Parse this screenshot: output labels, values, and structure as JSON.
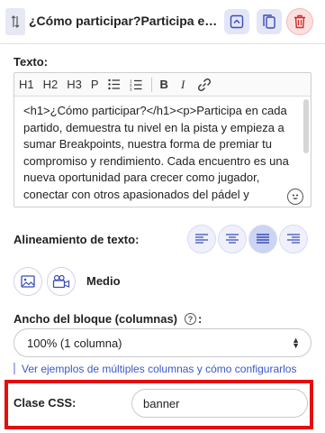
{
  "header": {
    "title": "¿Cómo participar?Participa en c...",
    "handle_icon": "drag-handle-icon",
    "collapse_icon": "chevron-up-icon",
    "copy_icon": "copy-icon",
    "delete_icon": "trash-icon"
  },
  "text_field": {
    "label": "Texto:",
    "toolbar": [
      "H1",
      "H2",
      "H3",
      "P",
      "B",
      "I"
    ],
    "content": "<h1>¿Cómo participar?</h1><p>Participa en cada partido, demuestra tu nivel en la pista y empieza a sumar Breakpoints, nuestra forma de premiar tu compromiso y rendimiento. Cada encuentro es una nueva oportunidad para crecer como jugador, conectar con otros apasionados del pádel y acercarte a tus objetivos. Cuantos"
  },
  "alignment": {
    "label": "Alineamiento de texto:",
    "active": "justify",
    "options": [
      "left",
      "center",
      "justify",
      "right"
    ]
  },
  "media": {
    "size_label": "Medio"
  },
  "block_width": {
    "label": "Ancho del bloque (columnas)",
    "colon": ":",
    "help_glyph": "?",
    "selected": "100% (1 columna)",
    "help_link": "Ver ejemplos de múltiples columnas y cómo configurarlos"
  },
  "css_class": {
    "label": "Clase CSS:",
    "value": "banner"
  },
  "colors": {
    "accent": "#3b57c9",
    "highlight_border": "#e50e0e",
    "button_bg": "#e3e6f7",
    "delete_bg": "#fbe0e0"
  }
}
